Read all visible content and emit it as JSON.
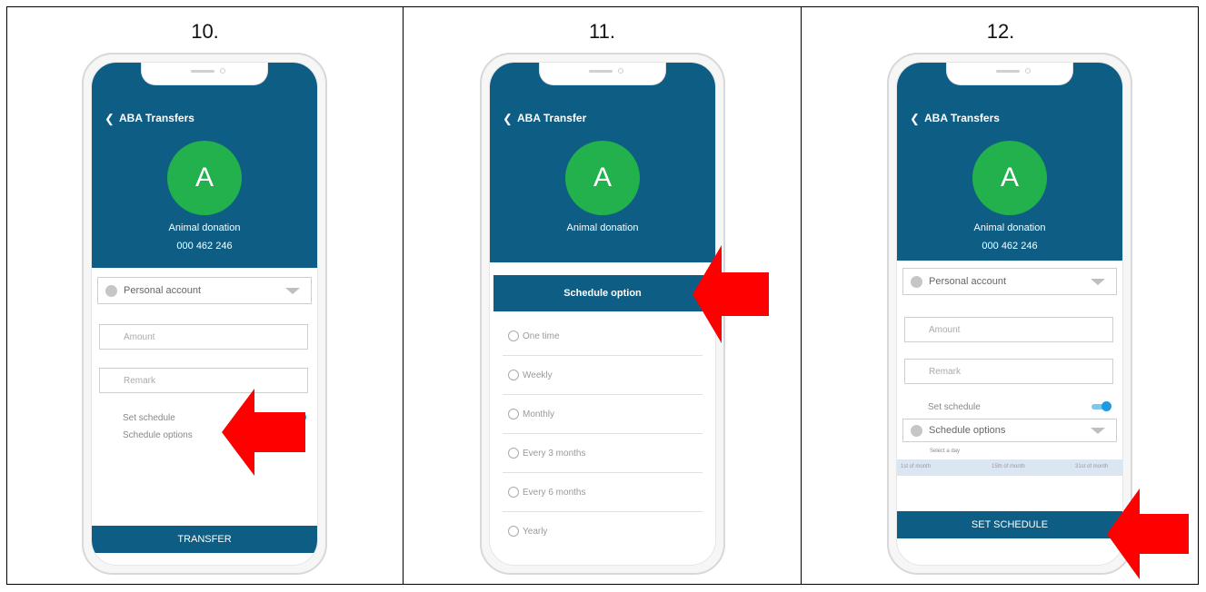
{
  "panels": [
    {
      "label": "10.",
      "header_title": "ABA Transfers",
      "avatar_letter": "A",
      "payee_name": "Animal donation",
      "payee_number": "000 462 246",
      "account_select": "Personal account",
      "amount_placeholder": "Amount",
      "remark_placeholder": "Remark",
      "set_schedule_label": "Set schedule",
      "schedule_options_label": "Schedule options",
      "button_label": "TRANSFER"
    },
    {
      "label": "11.",
      "header_title": "ABA Transfer",
      "avatar_letter": "A",
      "payee_name": "Animal donation",
      "schedule_header": "Schedule option",
      "options": [
        "One time",
        "Weekly",
        "Monthly",
        "Every 3 months",
        "Every 6 months",
        "Yearly"
      ]
    },
    {
      "label": "12.",
      "header_title": "ABA Transfers",
      "avatar_letter": "A",
      "payee_name": "Animal donation",
      "payee_number": "000 462 246",
      "account_select": "Personal account",
      "amount_placeholder": "Amount",
      "remark_placeholder": "Remark",
      "set_schedule_label": "Set schedule",
      "schedule_options_label": "Schedule options",
      "select_day_label": "Select a day",
      "day_options": [
        "1st of month",
        "15th of month",
        "31st of month"
      ],
      "button_label": "SET SCHEDULE"
    }
  ],
  "colors": {
    "header_blue": "#0d5d84",
    "avatar_green": "#22b14c",
    "arrow_red": "#ff0000",
    "toggle_blue": "#1e9be0"
  },
  "icons": {
    "back": "chevron-left-icon",
    "caret": "caret-down-icon",
    "pointer": "red-arrow-left-icon"
  }
}
